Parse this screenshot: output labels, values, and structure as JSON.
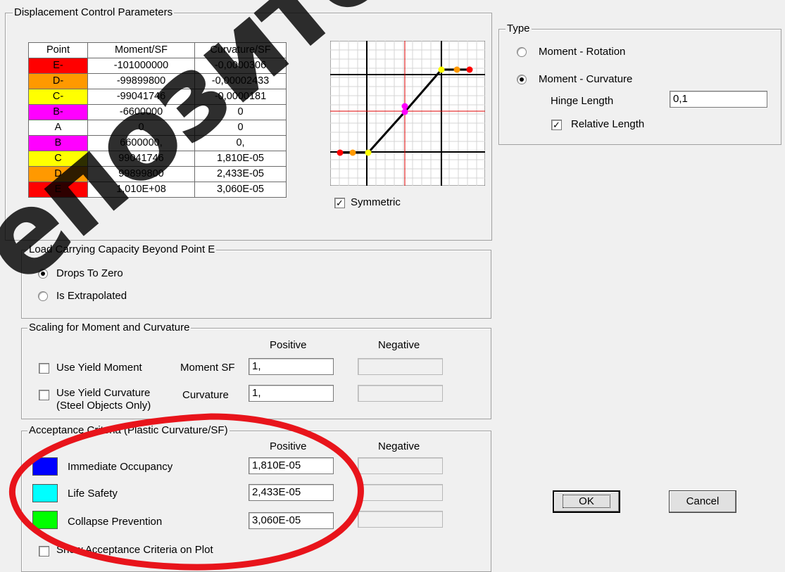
{
  "displacement": {
    "title": "Displacement Control Parameters",
    "table_headers": [
      "Point",
      "Moment/SF",
      "Curvature/SF"
    ],
    "rows": [
      {
        "point": "E-",
        "moment": "-101000000",
        "curvature": "-0,0000306",
        "color": "#ff0000"
      },
      {
        "point": "D-",
        "moment": "-99899800",
        "curvature": "-0,00002433",
        "color": "#ff9900"
      },
      {
        "point": "C-",
        "moment": "-99041746",
        "curvature": "-0,0000181",
        "color": "#ffff00"
      },
      {
        "point": "B-",
        "moment": "-6600000",
        "curvature": "0",
        "color": "#ff00ff"
      },
      {
        "point": "A",
        "moment": "0",
        "curvature": "0",
        "color": "#ffffff"
      },
      {
        "point": "B",
        "moment": "6600000,",
        "curvature": "0,",
        "color": "#ff00ff"
      },
      {
        "point": "C",
        "moment": "99041746",
        "curvature": "1,810E-05",
        "color": "#ffff00"
      },
      {
        "point": "D",
        "moment": "99899800",
        "curvature": "2,433E-05",
        "color": "#ff9900"
      },
      {
        "point": "E",
        "moment": "1,010E+08",
        "curvature": "3,060E-05",
        "color": "#ff0000"
      }
    ],
    "symmetric_label": "Symmetric",
    "symmetric_checked": true
  },
  "type_group": {
    "title": "Type",
    "option_rotation": "Moment - Rotation",
    "option_curvature": "Moment - Curvature",
    "selected": "Moment - Curvature",
    "hinge_length_label": "Hinge Length",
    "hinge_length_value": "0,1",
    "relative_length_label": "Relative Length",
    "relative_length_checked": true
  },
  "load_capacity": {
    "title": "Load Carrying Capacity Beyond Point E",
    "option_drops": "Drops To Zero",
    "option_extrapolated": "Is Extrapolated",
    "selected": "Drops To Zero"
  },
  "scaling": {
    "title": "Scaling for Moment and Curvature",
    "positive_header": "Positive",
    "negative_header": "Negative",
    "use_yield_moment": "Use Yield Moment",
    "moment_sf_label": "Moment SF",
    "moment_sf_value": "1,",
    "use_yield_curvature": "Use Yield Curvature",
    "steel_only_note": "(Steel Objects Only)",
    "curvature_label": "Curvature",
    "curvature_value": "1,"
  },
  "acceptance": {
    "title": "Acceptance Criteria (Plastic Curvature/SF)",
    "positive_header": "Positive",
    "negative_header": "Negative",
    "items": [
      {
        "label": "Immediate Occupancy",
        "value": "1,810E-05",
        "color": "#0000ff"
      },
      {
        "label": "Life Safety",
        "value": "2,433E-05",
        "color": "#00ffff"
      },
      {
        "label": "Collapse Prevention",
        "value": "3,060E-05",
        "color": "#00ff00"
      }
    ],
    "show_on_plot_label": "Show Acceptance Criteria on Plot"
  },
  "buttons": {
    "ok": "OK",
    "cancel": "Cancel"
  },
  "watermark": {
    "text": "епозитор"
  }
}
